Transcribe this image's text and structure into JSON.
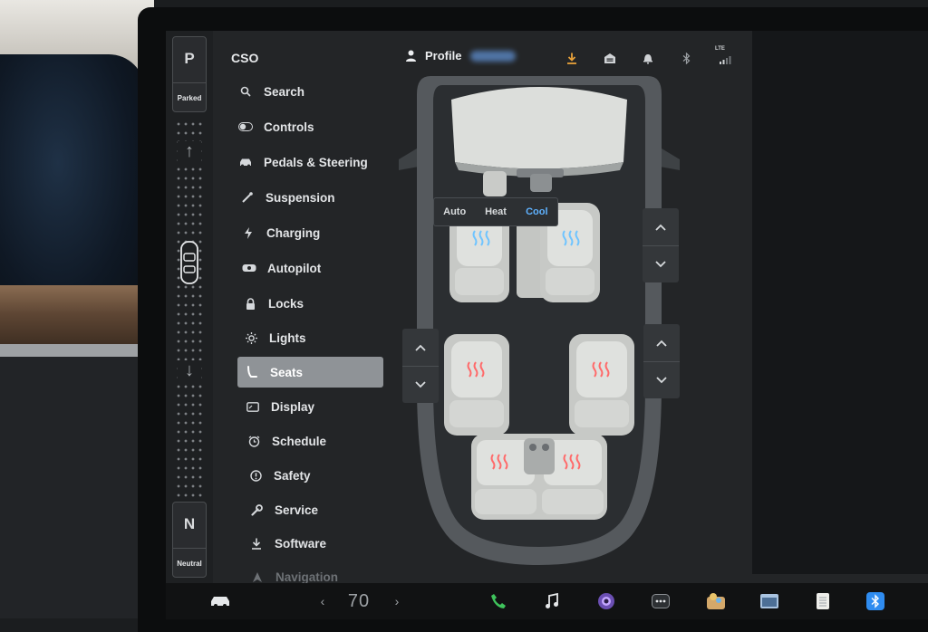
{
  "gear": {
    "top_letter": "P",
    "top_label": "Parked",
    "bottom_letter": "N",
    "bottom_label": "Neutral"
  },
  "menu": {
    "header": "CSO",
    "items": [
      {
        "label": "Search",
        "icon": "search-icon"
      },
      {
        "label": "Controls",
        "icon": "toggle-icon"
      },
      {
        "label": "Pedals & Steering",
        "icon": "car-icon"
      },
      {
        "label": "Suspension",
        "icon": "suspension-icon"
      },
      {
        "label": "Charging",
        "icon": "lightning-icon"
      },
      {
        "label": "Autopilot",
        "icon": "steering-wheel-icon"
      },
      {
        "label": "Locks",
        "icon": "lock-icon"
      },
      {
        "label": "Lights",
        "icon": "sun-icon"
      },
      {
        "label": "Seats",
        "icon": "seat-icon",
        "active": true
      },
      {
        "label": "Display",
        "icon": "display-icon"
      },
      {
        "label": "Schedule",
        "icon": "alarm-clock-icon"
      },
      {
        "label": "Safety",
        "icon": "exclamation-circle-icon"
      },
      {
        "label": "Service",
        "icon": "wrench-icon"
      },
      {
        "label": "Software",
        "icon": "download-icon"
      },
      {
        "label": "Navigation",
        "icon": "navigation-arrow-icon"
      }
    ]
  },
  "topbar": {
    "profile_label": "Profile",
    "status_icons": [
      "download-icon",
      "garage-icon",
      "bell-icon",
      "bluetooth-icon",
      "lte-signal-icon"
    ],
    "lte_text": "LTE"
  },
  "seat_mode": {
    "options": [
      "Auto",
      "Heat",
      "Cool"
    ],
    "selected": "Cool"
  },
  "taskbar": {
    "speed": "70",
    "apps": [
      "car-icon",
      "phone-icon",
      "music-note-icon",
      "camera-icon",
      "more-dots-icon",
      "games-icon",
      "window-icon",
      "notepad-icon",
      "bluetooth-icon"
    ]
  },
  "colors": {
    "accent_blue": "#5fb2ff",
    "cool_vent": "#6fc4ff",
    "heat_vent": "#ff6a6a",
    "active_menu": "#8f9397",
    "download_orange": "#e8a23a",
    "phone_green": "#3fc35c"
  }
}
